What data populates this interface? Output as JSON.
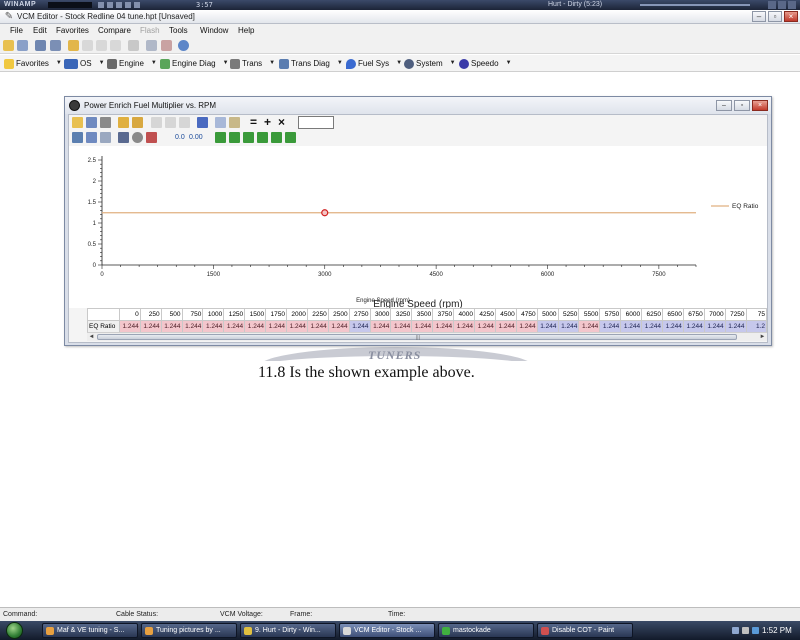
{
  "winamp": {
    "logo": "WINAMP",
    "time": "3:57",
    "track": "Hurt - Dirty (5:23)"
  },
  "window": {
    "title": "VCM Editor - Stock Redline 04 tune.hpt  [Unsaved]"
  },
  "menu": {
    "items": [
      "File",
      "Edit",
      "Favorites",
      "Compare",
      "Flash",
      "Tools",
      "Window",
      "Help"
    ],
    "disabled": [
      "Flash"
    ]
  },
  "nav_toolbar": {
    "items": [
      "Favorites",
      "OS",
      "Engine",
      "Engine Diag",
      "Trans",
      "Trans Diag",
      "Fuel Sys",
      "System",
      "Speedo"
    ]
  },
  "dialog": {
    "title": "Power Enrich Fuel Multiplier vs. RPM",
    "decimals_less": "0.0",
    "decimals_more": "0.00",
    "input_value": ""
  },
  "chart_data": {
    "type": "line",
    "x": [
      0,
      250,
      500,
      750,
      1000,
      1250,
      1500,
      1750,
      2000,
      2250,
      2500,
      2750,
      3000,
      3250,
      3500,
      3750,
      4000,
      4250,
      4500,
      4750,
      5000,
      5250,
      5500,
      5750,
      6000,
      6250,
      6500,
      6750,
      7000,
      7250,
      7500,
      7750,
      8000
    ],
    "series": [
      {
        "name": "EQ Ratio",
        "values": [
          1.244,
          1.244,
          1.244,
          1.244,
          1.244,
          1.244,
          1.244,
          1.244,
          1.244,
          1.244,
          1.244,
          1.244,
          1.244,
          1.244,
          1.244,
          1.244,
          1.244,
          1.244,
          1.244,
          1.244,
          1.244,
          1.244,
          1.244,
          1.244,
          1.244,
          1.244,
          1.244,
          1.244,
          1.244,
          1.244,
          1.244,
          1.244,
          1.244
        ]
      }
    ],
    "title": "",
    "xlabel": "Engine Speed (rpm)",
    "ylabel": "",
    "xlim": [
      0,
      8000
    ],
    "ylim": [
      0,
      2.5
    ],
    "xticks": [
      0,
      1500,
      3000,
      4500,
      6000,
      7500
    ],
    "yticks": [
      0,
      0.5,
      1,
      1.5,
      2,
      2.5
    ],
    "highlighted_x": 3000,
    "line_color": "#e0b080",
    "marker_color": "#d02020",
    "legend": "right"
  },
  "table": {
    "axis_title": "Engine Speed (rpm)",
    "row_label": "EQ Ratio",
    "columns": [
      "0",
      "250",
      "500",
      "750",
      "1000",
      "1250",
      "1500",
      "1750",
      "2000",
      "2250",
      "2500",
      "2750",
      "3000",
      "3250",
      "3500",
      "3750",
      "4000",
      "4250",
      "4500",
      "4750",
      "5000",
      "5250",
      "5500",
      "5750",
      "6000",
      "6250",
      "6500",
      "6750",
      "7000",
      "7250",
      "75"
    ],
    "values": [
      "1.244",
      "1.244",
      "1.244",
      "1.244",
      "1.244",
      "1.244",
      "1.244",
      "1.244",
      "1.244",
      "1.244",
      "1.244",
      "1.244",
      "1.244",
      "1.244",
      "1.244",
      "1.244",
      "1.244",
      "1.244",
      "1.244",
      "1.244",
      "1.244",
      "1.244",
      "1.244",
      "1.244",
      "1.244",
      "1.244",
      "1.244",
      "1.244",
      "1.244",
      "1.244",
      "1.2"
    ],
    "cell_shading": [
      "hot",
      "hot",
      "hot",
      "hot",
      "hot",
      "hot",
      "hot",
      "hot",
      "hot",
      "hot",
      "hot",
      "cool",
      "hot",
      "hot",
      "hot",
      "hot",
      "hot",
      "hot",
      "hot",
      "hot",
      "cool",
      "cool",
      "hot",
      "cool",
      "cool",
      "cool",
      "cool",
      "cool",
      "cool",
      "cool",
      "cool"
    ],
    "scroll_grip": "|||"
  },
  "page_overlay": {
    "logo_text": "TUNERS",
    "caption": "11.8 Is the shown example above."
  },
  "status": {
    "command": "Command:",
    "cable": "Cable Status:",
    "voltage": "VCM Voltage:",
    "frame": "Frame:",
    "time": "Time:"
  },
  "taskbar": {
    "tasks": [
      "Maf & VE tuning - S...",
      "Tuning pictures by ...",
      "9. Hurt - Dirty - Win...",
      "VCM Editor - Stock ...",
      "mastockade",
      "Disable COT - Paint"
    ],
    "active_index": 3,
    "clock": "1:52 PM"
  },
  "colors": {
    "accent_hot": "#f3c6cc",
    "accent_cool": "#c6c8ec"
  }
}
